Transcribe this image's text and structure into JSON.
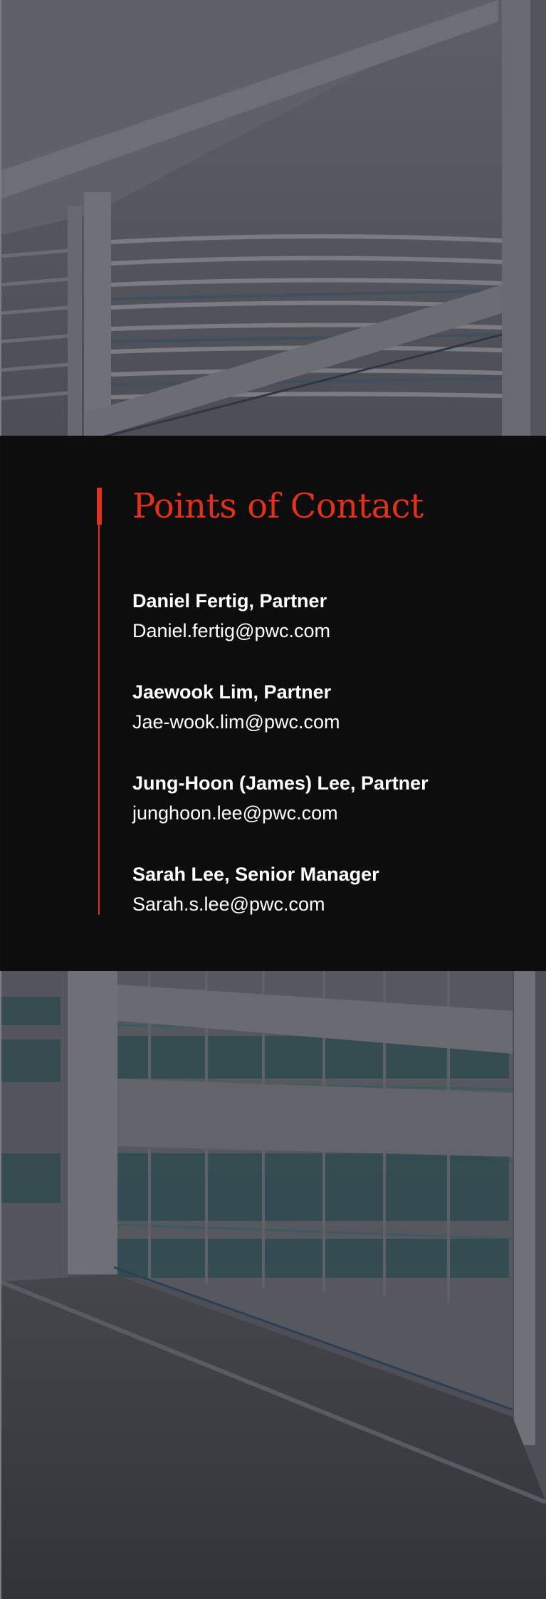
{
  "contact_section": {
    "title": "Points of Contact",
    "accent_color": "#e0301e",
    "contacts": [
      {
        "name": "Daniel Fertig, Partner",
        "email": "Daniel.fertig@pwc.com"
      },
      {
        "name": "Jaewook Lim, Partner",
        "email": "Jae-wook.lim@pwc.com"
      },
      {
        "name": "Jung-Hoon (James) Lee, Partner",
        "email": "junghoon.lee@pwc.com"
      },
      {
        "name": "Sarah Lee, Senior Manager",
        "email": "Sarah.s.lee@pwc.com"
      }
    ]
  }
}
